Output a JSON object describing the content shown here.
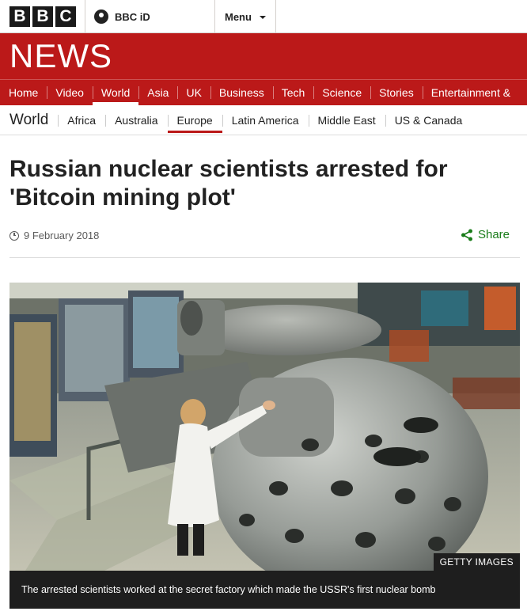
{
  "masthead": {
    "logo_letters": [
      "B",
      "B",
      "C"
    ],
    "bbc_id_label": "BBC iD",
    "menu_label": "Menu"
  },
  "banner": {
    "wordmark": "NEWS"
  },
  "primary_nav": {
    "items": [
      {
        "label": "Home"
      },
      {
        "label": "Video"
      },
      {
        "label": "World"
      },
      {
        "label": "Asia"
      },
      {
        "label": "UK"
      },
      {
        "label": "Business"
      },
      {
        "label": "Tech"
      },
      {
        "label": "Science"
      },
      {
        "label": "Stories"
      },
      {
        "label": "Entertainment &"
      }
    ],
    "active": "World"
  },
  "secondary_nav": {
    "section_title": "World",
    "items": [
      {
        "label": "Africa"
      },
      {
        "label": "Australia"
      },
      {
        "label": "Europe"
      },
      {
        "label": "Latin America"
      },
      {
        "label": "Middle East"
      },
      {
        "label": "US & Canada"
      }
    ],
    "active": "Europe"
  },
  "article": {
    "headline": "Russian nuclear scientists arrested for 'Bitcoin mining plot'",
    "date": "9 February 2018",
    "share_label": "Share",
    "image_credit": "GETTY IMAGES",
    "image_caption": "The arrested scientists worked at the secret factory which made the USSR's first nuclear bomb"
  },
  "icons": {
    "avatar": "user-avatar-icon",
    "menu_caret": "chevron-down-icon",
    "date": "clock-icon",
    "share": "share-icon"
  },
  "colors": {
    "brand_red": "#bb1919",
    "share_green": "#1a7c1a"
  }
}
